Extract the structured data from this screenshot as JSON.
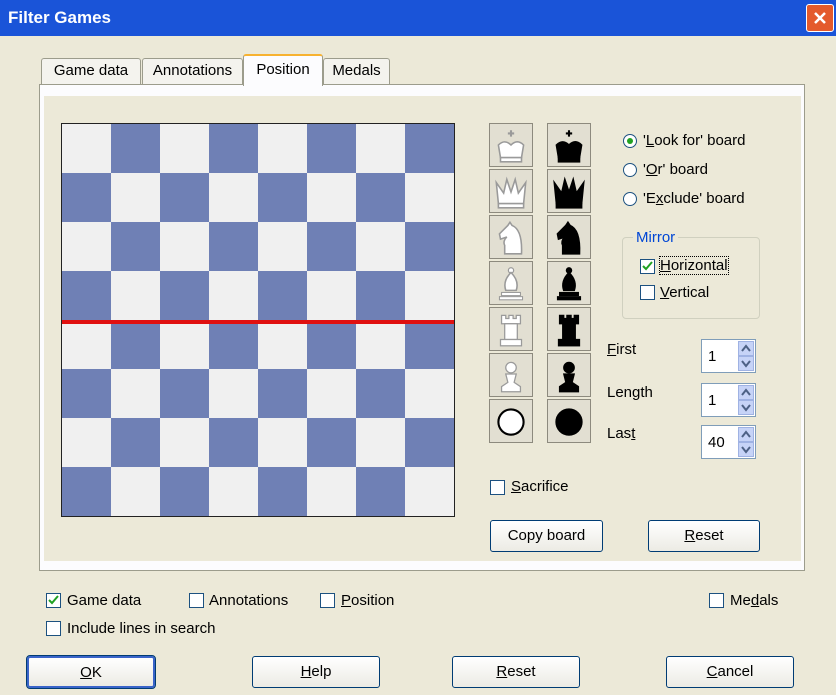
{
  "window": {
    "title": "Filter Games"
  },
  "tabs": [
    {
      "label": "Game data"
    },
    {
      "label": "Annotations"
    },
    {
      "label": "Position"
    },
    {
      "label": "Medals"
    }
  ],
  "board": {
    "light_color": "#f0f0f0",
    "dark_color": "#6f80b5",
    "divider_color": "#e01010"
  },
  "pieces": {
    "white": [
      "white-king",
      "white-queen",
      "white-knight",
      "white-bishop",
      "white-rook",
      "white-pawn",
      "white-disc"
    ],
    "black": [
      "black-king",
      "black-queen",
      "black-knight",
      "black-bishop",
      "black-rook",
      "black-pawn",
      "black-disc"
    ]
  },
  "board_mode": {
    "options": [
      {
        "pre": "'",
        "key": "L",
        "post": "ook for' board",
        "selected": true
      },
      {
        "pre": "'",
        "key": "O",
        "post": "r' board",
        "selected": false
      },
      {
        "pre": "'E",
        "key": "x",
        "post": "clude' board",
        "selected": false
      }
    ]
  },
  "mirror": {
    "title": "Mirror",
    "horizontal": {
      "key": "H",
      "rest": "orizontal",
      "checked": true
    },
    "vertical": {
      "key": "V",
      "rest": "ertical",
      "checked": false
    }
  },
  "moves": {
    "first": {
      "key": "F",
      "rest": "irst",
      "value": "1"
    },
    "length": {
      "pre": "Len",
      "key": "g",
      "post": "th",
      "value": "1"
    },
    "last": {
      "pre": "Las",
      "key": "t",
      "post": "",
      "value": "40"
    }
  },
  "sacrifice": {
    "key": "S",
    "rest": "acrifice",
    "checked": false
  },
  "panel_buttons": {
    "copy_board": "Copy board",
    "reset": {
      "key": "R",
      "rest": "eset"
    }
  },
  "bottom_checks": {
    "game_data": {
      "label": "Game data",
      "checked": true
    },
    "annotations": {
      "label": "Annotations",
      "checked": false
    },
    "position": {
      "key": "P",
      "rest": "osition",
      "checked": false
    },
    "medals": {
      "pre": "Me",
      "key": "d",
      "post": "als",
      "checked": false
    },
    "include_lines": {
      "label": "Include lines in search",
      "checked": false
    }
  },
  "dialog_buttons": {
    "ok": {
      "key": "O",
      "rest": "K"
    },
    "help": {
      "key": "H",
      "rest": "elp"
    },
    "reset": {
      "key": "R",
      "rest": "eset"
    },
    "cancel": {
      "key": "C",
      "rest": "ancel"
    }
  }
}
